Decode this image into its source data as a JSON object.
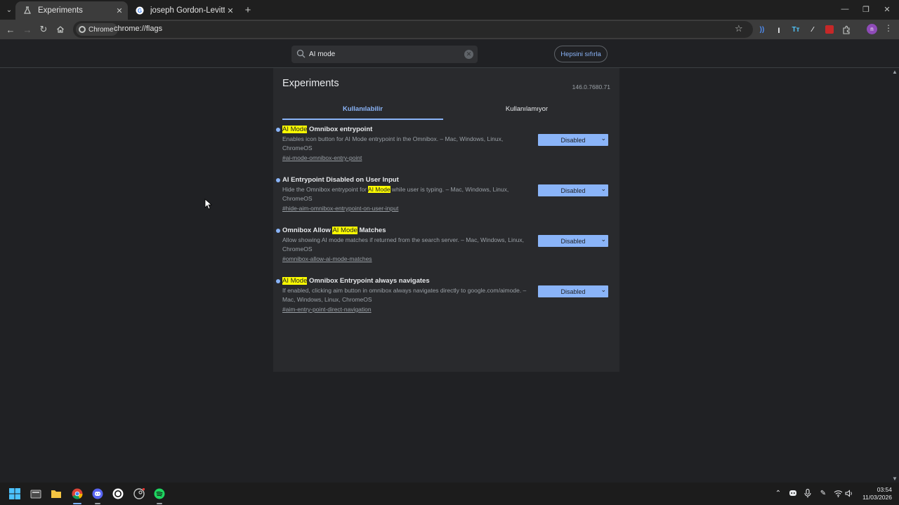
{
  "browser": {
    "tabs": [
      {
        "title": "Experiments",
        "favicon": "flask-icon",
        "active": true
      },
      {
        "title": "joseph Gordon-Levitt - Google",
        "favicon": "google-icon",
        "active": false
      }
    ],
    "omnibox": {
      "chip_label": "Chrome",
      "url": "chrome://flags"
    },
    "extension_icons": [
      "copilot-icon",
      "stroke-icon",
      "tt-icon",
      "pen-icon",
      "ublock-icon",
      "puzzle-icon"
    ],
    "profile_initial": "n"
  },
  "flags_header": {
    "search_value": "AI mode",
    "reset_label": "Hepsini sıfırla"
  },
  "panel": {
    "title": "Experiments",
    "version": "146.0.7680.71",
    "tabs": {
      "available": "Kullanılabilir",
      "unavailable": "Kullanılamıyor"
    }
  },
  "flags": [
    {
      "title_pre": "",
      "title_hl": "AI Mode",
      "title_post": " Omnibox entrypoint",
      "desc_pre": "Enables icon button for AI Mode entrypoint in the Omnibox. – Mac, Windows, Linux, ChromeOS",
      "desc_hl": "",
      "desc_post": "",
      "link": "#ai-mode-omnibox-entry-point",
      "value": "Disabled"
    },
    {
      "title_pre": "AI Entrypoint Disabled on User Input",
      "title_hl": "",
      "title_post": "",
      "desc_pre": "Hide the Omnibox entrypoint for ",
      "desc_hl": "AI Mode",
      "desc_post": " while user is typing. – Mac, Windows, Linux, ChromeOS",
      "link": "#hide-aim-omnibox-entrypoint-on-user-input",
      "value": "Disabled"
    },
    {
      "title_pre": "Omnibox Allow ",
      "title_hl": "AI Mode",
      "title_post": " Matches",
      "desc_pre": "Allow showing AI mode matches if returned from the search server. – Mac, Windows, Linux, ChromeOS",
      "desc_hl": "",
      "desc_post": "",
      "link": "#omnibox-allow-ai-mode-matches",
      "value": "Disabled"
    },
    {
      "title_pre": "",
      "title_hl": "AI Mode",
      "title_post": " Omnibox Entrypoint always navigates",
      "desc_pre": "If enabled, clicking aim button in omnibox always navigates directly to google.com/aimode. – Mac, Windows, Linux, ChromeOS",
      "desc_hl": "",
      "desc_post": "",
      "link": "#aim-entry-point-direct-navigation",
      "value": "Disabled"
    }
  ],
  "taskbar": {
    "time": "03:54",
    "date": "11/03/2026",
    "pinned": [
      "windows-start-icon",
      "file-explorer-icon",
      "folder-icon",
      "chrome-icon",
      "discord-icon",
      "chatgpt-icon",
      "steam-icon",
      "spotify-icon"
    ]
  }
}
